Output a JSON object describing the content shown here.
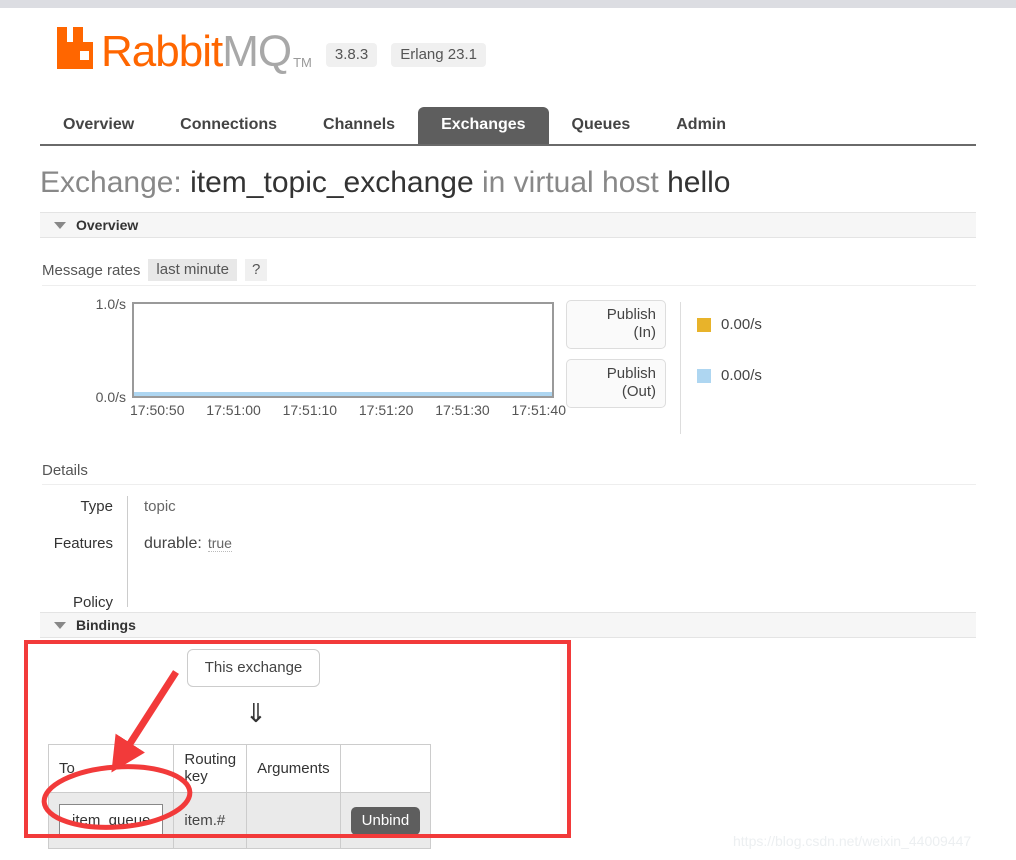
{
  "brand": {
    "name_part1": "Rabbit",
    "name_part2": "MQ",
    "tm": "TM",
    "version": "3.8.3",
    "erlang": "Erlang 23.1",
    "logo_color": "#ff6600"
  },
  "nav": {
    "tabs": [
      {
        "label": "Overview",
        "active": false
      },
      {
        "label": "Connections",
        "active": false
      },
      {
        "label": "Channels",
        "active": false
      },
      {
        "label": "Exchanges",
        "active": true
      },
      {
        "label": "Queues",
        "active": false
      },
      {
        "label": "Admin",
        "active": false
      }
    ]
  },
  "page": {
    "title_prefix": "Exchange:",
    "exchange_name": "item_topic_exchange",
    "title_middle": "in virtual host",
    "vhost": "hello"
  },
  "overview": {
    "section_label": "Overview",
    "rates_label": "Message rates",
    "period_button": "last minute",
    "help_button": "?"
  },
  "chart_data": {
    "type": "line",
    "title": "Message rates",
    "xlabel": "",
    "ylabel": "",
    "ylim": [
      0.0,
      1.0
    ],
    "y_ticks": [
      "0.0/s",
      "1.0/s"
    ],
    "x": [
      "17:50:50",
      "17:51:00",
      "17:51:10",
      "17:51:20",
      "17:51:30",
      "17:51:40"
    ],
    "grid": false,
    "legend_position": "right",
    "series": [
      {
        "name": "Publish (In)",
        "color": "#e8b32a",
        "current_value": "0.00/s",
        "values": [
          0,
          0,
          0,
          0,
          0,
          0
        ]
      },
      {
        "name": "Publish (Out)",
        "color": "#aed6f1",
        "current_value": "0.00/s",
        "values": [
          0,
          0,
          0,
          0,
          0,
          0
        ]
      }
    ]
  },
  "legend": {
    "publish_in_label": "Publish\n(In)",
    "publish_in_line1": "Publish",
    "publish_in_line2": "(In)",
    "publish_out_line1": "Publish",
    "publish_out_line2": "(Out)",
    "publish_in_value": "0.00/s",
    "publish_out_value": "0.00/s"
  },
  "details": {
    "heading": "Details",
    "type_key": "Type",
    "type_value": "topic",
    "features_key": "Features",
    "features_label": "durable:",
    "features_value": "true",
    "policy_key": "Policy",
    "policy_value": ""
  },
  "bindings": {
    "section_label": "Bindings",
    "this_exchange_button": "This exchange",
    "flow_arrow": "⇓",
    "columns": [
      "To",
      "Routing key",
      "Arguments",
      ""
    ],
    "rows": [
      {
        "to": "item_queue",
        "routing_key": "item.#",
        "arguments": "",
        "action": "Unbind"
      }
    ]
  },
  "annotations": {
    "highlight_color": "#f23a3a"
  },
  "watermark": {
    "text": "https://blog.csdn.net/weixin_44009447"
  }
}
